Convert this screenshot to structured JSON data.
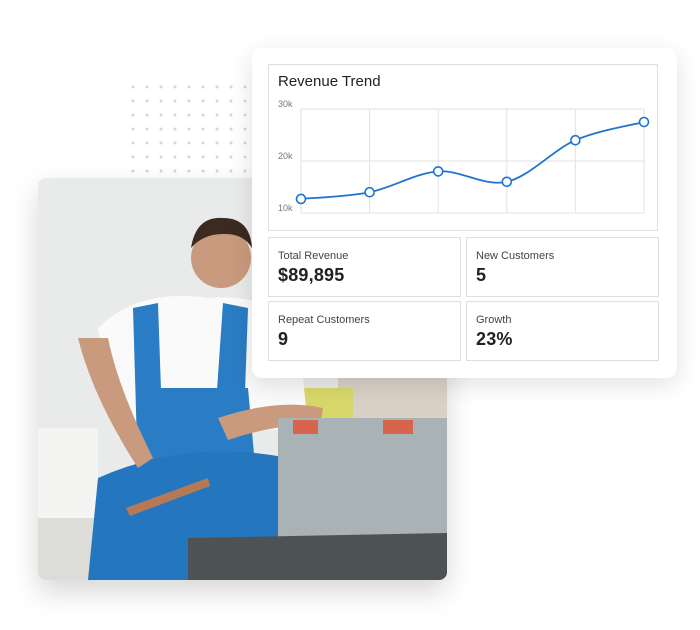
{
  "card": {
    "title": "Revenue Trend",
    "stats": [
      {
        "label": "Total Revenue",
        "value": "$89,895"
      },
      {
        "label": "New Customers",
        "value": "5"
      },
      {
        "label": "Repeat Customers",
        "value": "9"
      },
      {
        "label": "Growth",
        "value": "23%"
      }
    ]
  },
  "photo": {
    "description": "smiling worker in blue overalls kneeling beside an open gray toolbox"
  },
  "colors": {
    "line": "#1f74d0",
    "grid": "#e2e2e2",
    "axis_text": "#777777"
  },
  "chart_data": {
    "type": "line",
    "title": "Revenue Trend",
    "xlabel": "",
    "ylabel": "",
    "x": [
      1,
      2,
      3,
      4,
      5,
      6
    ],
    "yticks": [
      "10k",
      "20k",
      "30k"
    ],
    "ylim": [
      10000,
      30000
    ],
    "grid": true,
    "series": [
      {
        "name": "Revenue",
        "values": [
          12700,
          14000,
          18000,
          16000,
          24000,
          27500
        ]
      }
    ]
  }
}
